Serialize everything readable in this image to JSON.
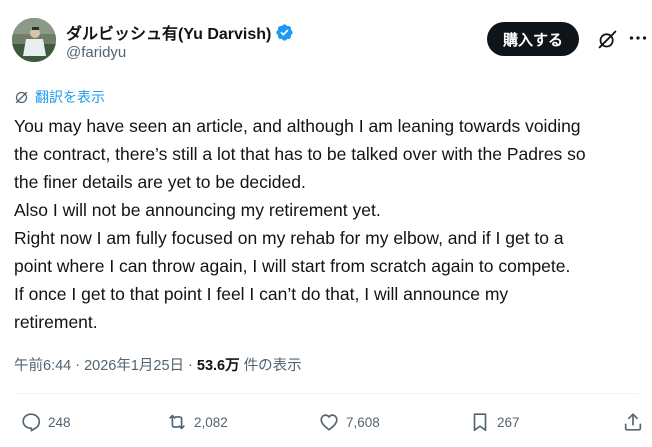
{
  "author": {
    "display_name": "ダルビッシュ有(Yu Darvish)",
    "handle": "@faridyu",
    "verified_color": "#1d9bf0"
  },
  "header": {
    "subscribe_label": "購入する",
    "grok_icon": "grok-icon",
    "more_icon": "more-icon"
  },
  "translate": {
    "label": "翻訳を表示"
  },
  "tweet": {
    "lines": [
      "You may have seen an article, and although I am leaning towards voiding",
      "the contract, there’s still a lot that has to be talked over with the Padres so",
      "the finer details are yet to be decided.",
      "Also I will not be announcing my retirement yet.",
      "Right now I am fully focused on my rehab for my elbow, and if I get to a",
      "point where I can throw again, I will start from scratch again to compete.",
      "If once I get to that point I feel I can’t do that, I will announce my",
      "retirement."
    ]
  },
  "meta": {
    "time": "午前6:44",
    "separator": "·",
    "date": "2026年1月25日",
    "views_count": "53.6万",
    "views_label": "件の表示"
  },
  "actions": {
    "replies": "248",
    "reposts": "2,082",
    "likes": "7,608",
    "bookmarks": "267"
  },
  "colors": {
    "accent": "#1d9bf0",
    "text_primary": "#0f1419",
    "text_secondary": "#536471",
    "divider": "#eff3f4"
  }
}
